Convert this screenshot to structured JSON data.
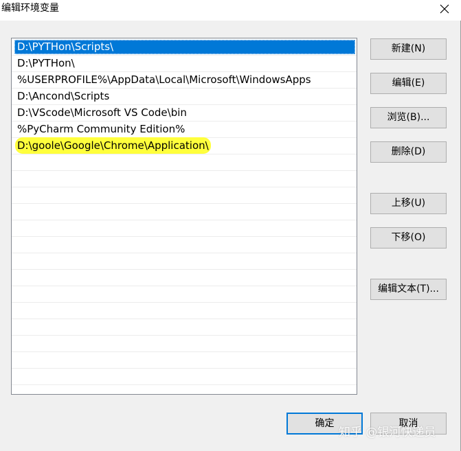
{
  "window": {
    "title": "编辑环境变量"
  },
  "paths": [
    "D:\\PYTHon\\Scripts\\",
    "D:\\PYTHon\\",
    "%USERPROFILE%\\AppData\\Local\\Microsoft\\WindowsApps",
    "D:\\Ancond\\Scripts",
    "D:\\VScode\\Microsoft VS Code\\bin",
    "%PyCharm Community Edition%",
    "D:\\goole\\Google\\Chrome\\Application\\"
  ],
  "selected_index": 0,
  "highlighted_index": 6,
  "highlight_color": "#ffff3c",
  "selection_color": "#0078d7",
  "buttons": {
    "new": "新建(N)",
    "edit": "编辑(E)",
    "browse": "浏览(B)...",
    "delete": "删除(D)",
    "move_up": "上移(U)",
    "move_down": "下移(O)",
    "edit_text": "编辑文本(T)...",
    "ok": "确定",
    "cancel": "取消"
  },
  "watermark": "知乎 @银河快递员",
  "icons": {
    "close": "close-icon"
  }
}
